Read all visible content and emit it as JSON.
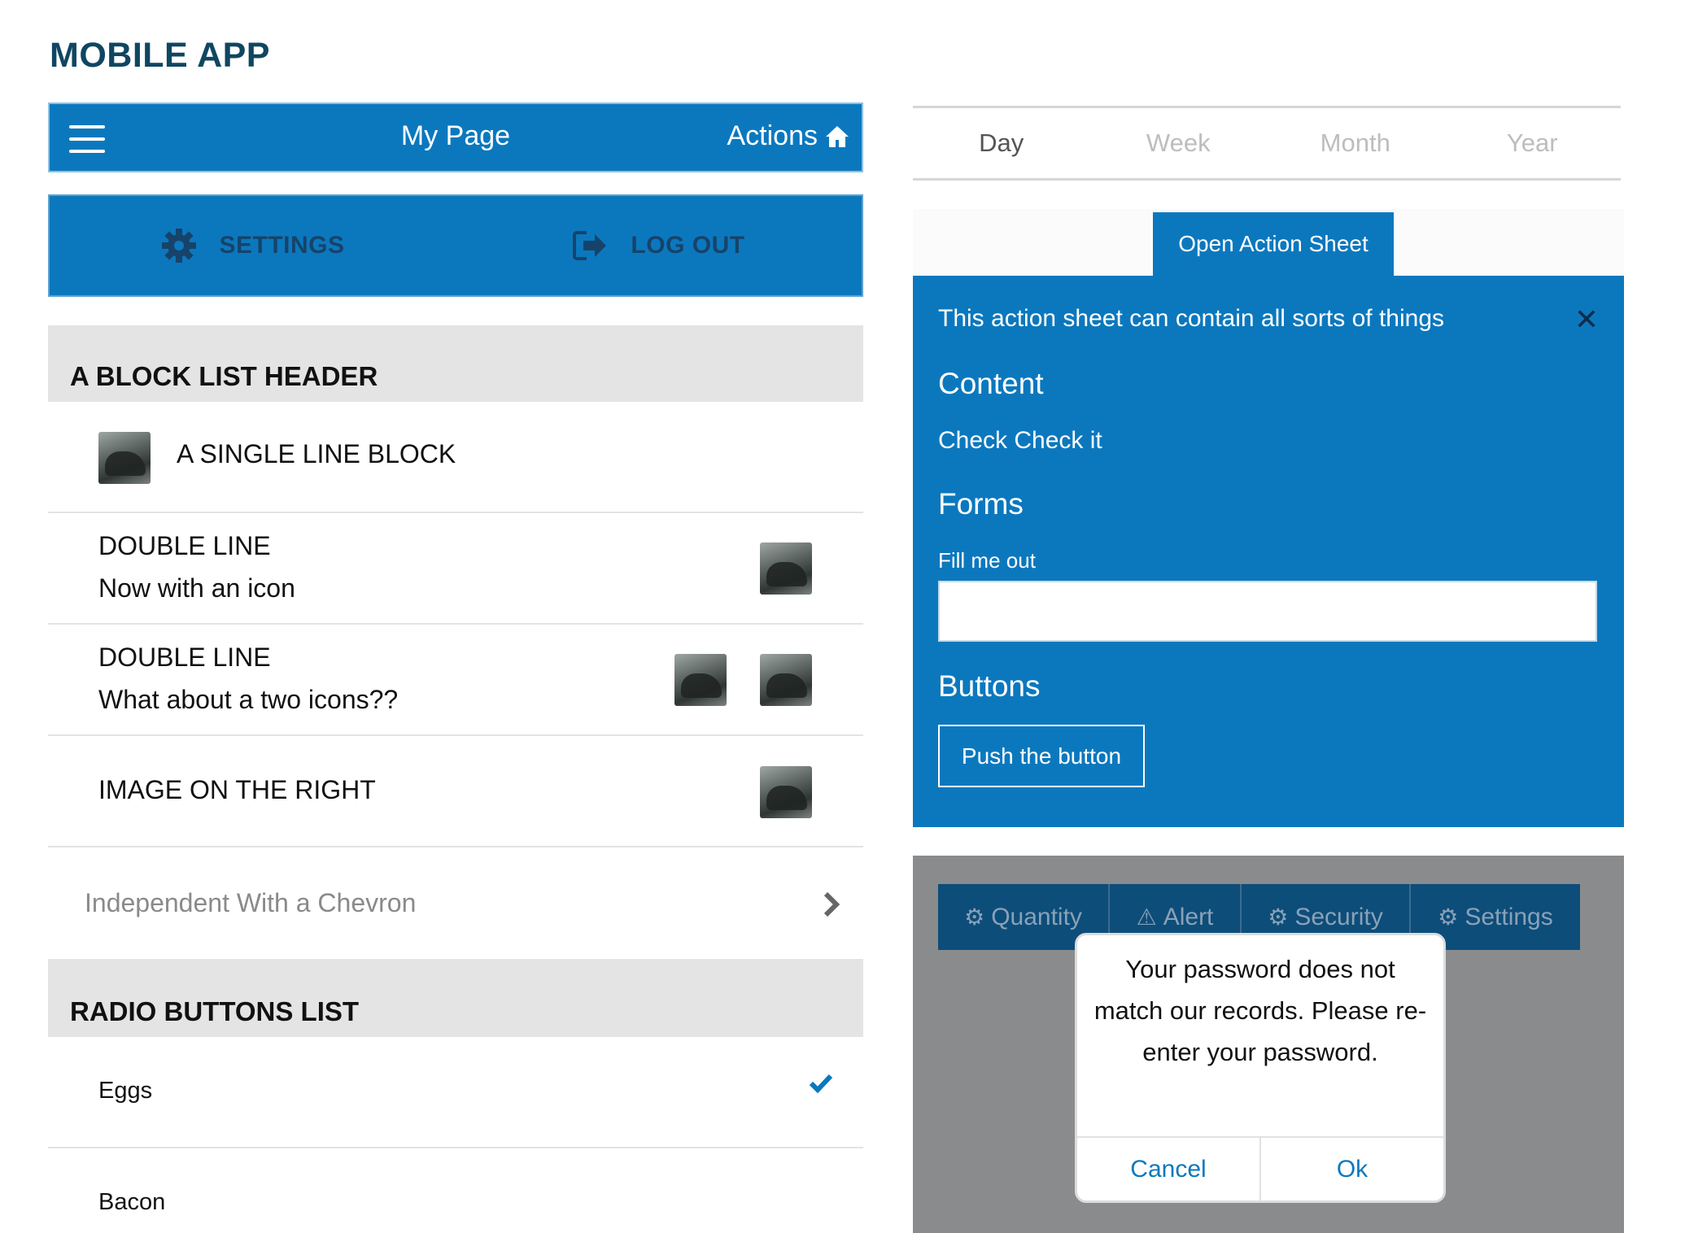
{
  "page": {
    "title": "MOBILE APP"
  },
  "navbar": {
    "title": "My Page",
    "actions_label": "Actions",
    "menu_icon": "hamburger-icon",
    "actions_icon": "home-icon"
  },
  "tabbar": {
    "items": [
      {
        "label": "SETTINGS",
        "icon": "gear-icon"
      },
      {
        "label": "LOG OUT",
        "icon": "logout-icon"
      }
    ]
  },
  "block_list": {
    "header": "A BLOCK LIST HEADER",
    "rows": [
      {
        "line1": "A SINGLE LINE BLOCK"
      },
      {
        "line1": "DOUBLE LINE",
        "line2": "Now with an icon"
      },
      {
        "line1": "DOUBLE LINE",
        "line2": "What about a two icons??"
      },
      {
        "line1": "IMAGE ON THE RIGHT"
      },
      {
        "line1": "Independent With a Chevron"
      }
    ]
  },
  "radio_list": {
    "header": "RADIO BUTTONS LIST",
    "items": [
      {
        "label": "Eggs",
        "checked": true
      },
      {
        "label": "Bacon",
        "checked": false
      }
    ]
  },
  "segments": {
    "items": [
      "Day",
      "Week",
      "Month",
      "Year"
    ],
    "active": "Day"
  },
  "action_sheet": {
    "open_button": "Open Action Sheet",
    "description": "This action sheet can contain all sorts of things",
    "content_heading": "Content",
    "content_text": "Check Check it",
    "forms_heading": "Forms",
    "field_label": "Fill me out",
    "field_value": "",
    "buttons_heading": "Buttons",
    "push_button": "Push the button"
  },
  "toolbar": {
    "items": [
      {
        "label": "Quantity",
        "icon": "gears-icon"
      },
      {
        "label": "Alert",
        "icon": "warning-icon"
      },
      {
        "label": "Security",
        "icon": "gears-icon"
      },
      {
        "label": "Settings",
        "icon": "gears-icon"
      }
    ]
  },
  "alert_dialog": {
    "message": "Your password does not match our records. Please re-enter your password.",
    "cancel": "Cancel",
    "ok": "Ok"
  },
  "colors": {
    "primary": "#0b78be",
    "dark_primary": "#0d4d7a",
    "title": "#0f4661",
    "overlay": "#8a8b8c"
  }
}
